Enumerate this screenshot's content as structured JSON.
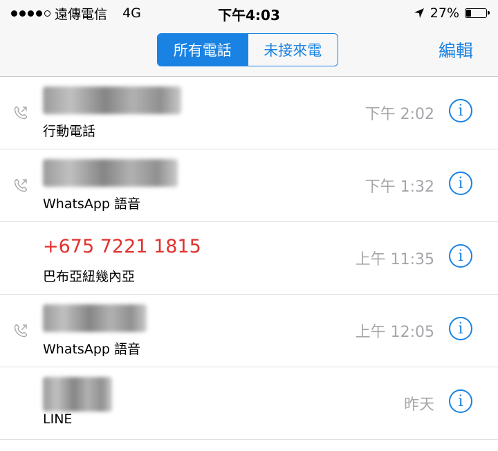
{
  "status_bar": {
    "carrier": "遠傳電信",
    "network": "4G",
    "time": "下午4:03",
    "battery_percent": "27%",
    "battery_level": 0.27
  },
  "nav": {
    "segments": [
      {
        "label": "所有電話",
        "active": true
      },
      {
        "label": "未接來電",
        "active": false
      }
    ],
    "edit_label": "編輯"
  },
  "calls": [
    {
      "name": "",
      "name_hidden": true,
      "subtitle": "行動電話",
      "time": "下午 2:02",
      "outgoing": true,
      "missed": false
    },
    {
      "name": "",
      "name_hidden": true,
      "subtitle": "WhatsApp 語音",
      "time": "下午 1:32",
      "outgoing": true,
      "missed": false
    },
    {
      "name": "+675 7221 1815",
      "name_hidden": false,
      "subtitle": "巴布亞紐幾內亞",
      "time": "上午 11:35",
      "outgoing": false,
      "missed": true
    },
    {
      "name": "",
      "name_hidden": true,
      "subtitle": "WhatsApp 語音",
      "time": "上午 12:05",
      "outgoing": true,
      "missed": false
    },
    {
      "name": "",
      "name_hidden": true,
      "subtitle": "LINE",
      "time": "昨天",
      "outgoing": false,
      "missed": false
    }
  ],
  "icons": {
    "outgoing_call": "outgoing-call-icon",
    "info": "info-icon",
    "location": "location-arrow-icon",
    "battery": "battery-icon"
  },
  "colors": {
    "accent": "#1a82e2",
    "missed": "#e2322e",
    "time": "#a6a6aa"
  }
}
